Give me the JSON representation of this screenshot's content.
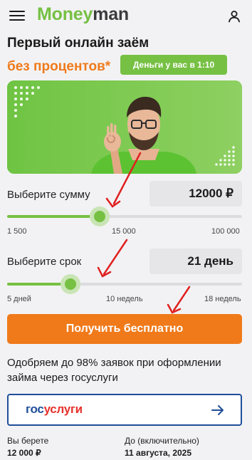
{
  "header": {
    "logo_part1": "Money",
    "logo_part2": "man"
  },
  "hero": {
    "title": "Первый онлайн заём",
    "subtitle": "без процентов*",
    "badge": "Деньги у вас в 1:10"
  },
  "amount": {
    "label": "Выберите сумму",
    "value": "12000 ₽",
    "min_label": "1 500",
    "mid_label": "15 000",
    "max_label": "100 000",
    "slider_fraction": 0.395
  },
  "term": {
    "label": "Выберите срок",
    "value": "21 день",
    "min_label": "5 дней",
    "mid_label": "10 недель",
    "max_label": "18 недель",
    "slider_fraction": 0.27
  },
  "cta": {
    "label": "Получить бесплатно"
  },
  "approval_text": "Одобряем до 98% заявок при оформлении займа через госуслуги",
  "gosuslugi": {
    "logo_part1": "гос",
    "logo_part2": "услуги"
  },
  "summary": {
    "take_label": "Вы берете",
    "take_value": "12 000 ₽",
    "until_label": "До (включительно)",
    "until_value": "11 августа, 2025"
  },
  "colors": {
    "brand_green": "#76c043",
    "accent_orange": "#f07a1a",
    "gosuslugi_blue": "#1f4e99",
    "gosuslugi_red": "#e6322d",
    "annotation_red": "#e02020"
  },
  "icons": [
    "menu-icon",
    "user-icon",
    "arrow-right-icon"
  ]
}
